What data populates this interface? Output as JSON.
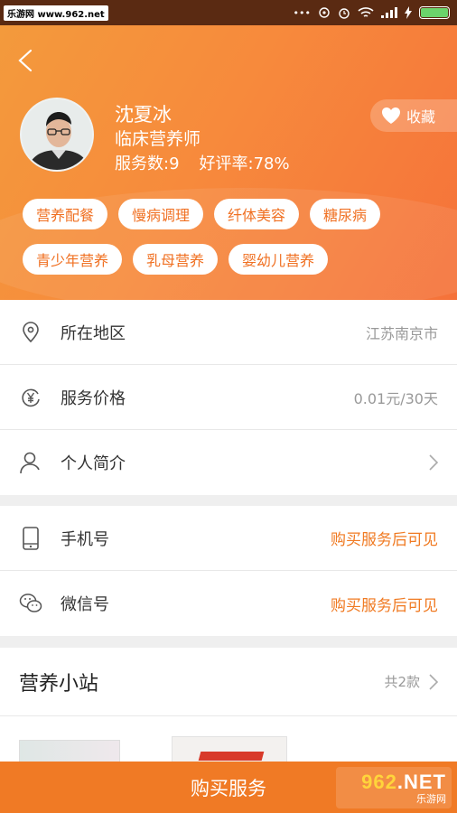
{
  "status_bar": {
    "watermark": "乐游网 www.962.net",
    "dots": "•••"
  },
  "profile": {
    "name": "沈夏冰",
    "title": "临床营养师",
    "service_count": "服务数:9",
    "rating": "好评率:78%",
    "favorite_label": "收藏",
    "tags": [
      "营养配餐",
      "慢病调理",
      "纤体美容",
      "糖尿病",
      "青少年营养",
      "乳母营养",
      "婴幼儿营养"
    ]
  },
  "info_rows": [
    {
      "label": "所在地区",
      "value": "江苏南京市",
      "icon": "location-pin-icon"
    },
    {
      "label": "服务价格",
      "value": "0.01元/30天",
      "icon": "yuan-circle-icon"
    },
    {
      "label": "个人简介",
      "value": "",
      "icon": "person-icon"
    }
  ],
  "contact_rows": [
    {
      "label": "手机号",
      "value": "购买服务后可见",
      "icon": "phone-icon"
    },
    {
      "label": "微信号",
      "value": "购买服务后可见",
      "icon": "wechat-icon"
    }
  ],
  "station": {
    "title": "营养小站",
    "count": "共2款"
  },
  "buy_button": "购买服务",
  "badge": {
    "top_nums": "962",
    "top_suffix": ".NET",
    "bottom": "乐游网"
  },
  "colors": {
    "accent": "#f07a22",
    "header_start": "#f39a3c",
    "header_end": "#f5723a"
  }
}
